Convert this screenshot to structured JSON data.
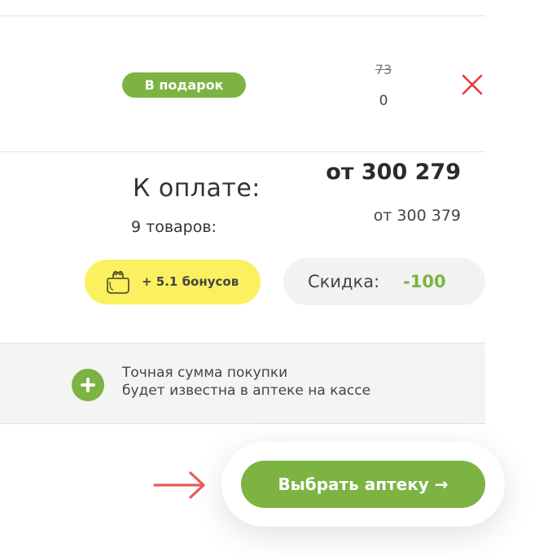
{
  "product_row": {
    "gift_badge": "В подарок",
    "old_price": "73",
    "price": "0",
    "remove_icon": "close-icon",
    "remove_color": "#e53935"
  },
  "summary": {
    "pay_label": "К оплате:",
    "total": "от 300 279",
    "items_count": "9 товаров:",
    "old_total": "от 300 379"
  },
  "bonus": {
    "icon": "wallet-icon",
    "label": "+ 5.1 бонусов",
    "background": "#fbf05f"
  },
  "discount": {
    "label": "Скидка:",
    "value": "-100"
  },
  "info": {
    "icon": "plus-icon",
    "line1": "Точная сумма покупки",
    "line2": "будет известна в аптеке на кассе"
  },
  "cta": {
    "label": "Выбрать аптеку →",
    "pointer_icon": "arrow-right-icon"
  },
  "colors": {
    "accent_green": "#7cb342",
    "pointer_red": "#e85a56"
  }
}
